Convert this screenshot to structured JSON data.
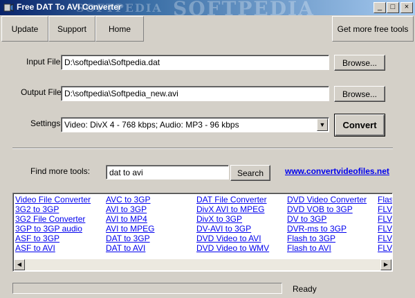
{
  "window": {
    "title": "Free DAT To AVI Converter",
    "watermark": "SOFTPEDIA",
    "controls": [
      "_",
      "□",
      "×"
    ]
  },
  "toolbar": {
    "update": "Update",
    "support": "Support",
    "home": "Home",
    "more_tools": "Get more free tools"
  },
  "form": {
    "input_label": "Input File",
    "input_value": "D:\\softpedia\\Softpedia.dat",
    "output_label": "Output File",
    "output_value": "D:\\softpedia\\Softpedia_new.avi",
    "settings_label": "Settings",
    "settings_value": "Video: DivX 4 - 768 kbps; Audio: MP3 - 96 kbps",
    "browse": "Browse...",
    "convert": "Convert"
  },
  "find": {
    "label": "Find more tools:",
    "query": "dat to avi",
    "search": "Search",
    "site": "www.convertvideofiles.net"
  },
  "links": [
    [
      "Video File Converter",
      "3G2 to 3GP",
      "3G2 File Converter",
      "3GP to 3GP audio",
      "ASF to 3GP",
      "ASF to AVI"
    ],
    [
      "AVC to 3GP",
      "AVI to 3GP",
      "AVI to MP4",
      "AVI to MPEG",
      "DAT to 3GP",
      "DAT to AVI"
    ],
    [
      "DAT File Converter",
      "DivX AVI to MPEG",
      "DivX to 3GP",
      "DV-AVI to 3GP",
      "DVD Video to AVI",
      "DVD Video to WMV"
    ],
    [
      "DVD Video Converter",
      "DVD VOB to 3GP",
      "DV to 3GP",
      "DVR-ms to 3GP",
      "Flash to 3GP",
      "Flash to AVI"
    ],
    [
      "Flash",
      "FLV",
      "FLV",
      "FLV",
      "FLV",
      "FLV"
    ]
  ],
  "status": {
    "progress": 0,
    "text": "Ready"
  }
}
